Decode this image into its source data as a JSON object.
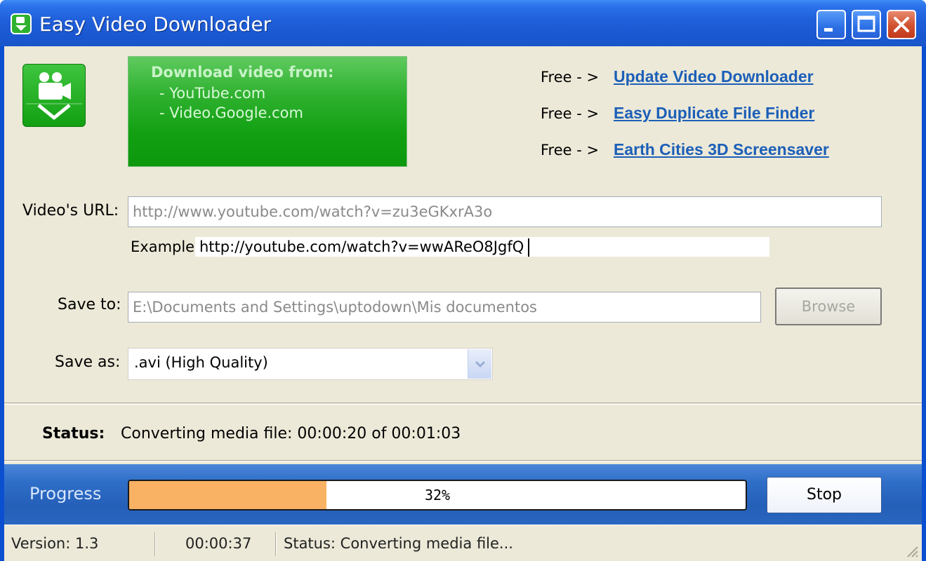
{
  "window": {
    "title": "Easy Video Downloader",
    "icon": "video-download-icon",
    "controls": [
      "minimize-icon",
      "maximize-icon",
      "close-icon"
    ]
  },
  "banner": {
    "title": "Download video from:",
    "sources": [
      "- YouTube.com",
      "- Video.Google.com"
    ]
  },
  "free_links": [
    {
      "prefix": "Free - >",
      "label": "Update Video Downloader"
    },
    {
      "prefix": "Free - >",
      "label": "Easy Duplicate File Finder"
    },
    {
      "prefix": "Free - >",
      "label": "Earth Cities 3D Screensaver"
    }
  ],
  "form": {
    "url_label": "Video's URL:",
    "url_value": "http://www.youtube.com/watch?v=zu3eGKxrA3o",
    "example_label": "Example:",
    "example_value": "http://youtube.com/watch?v=wwAReO8JgfQ",
    "save_to_label": "Save to:",
    "save_to_value": "E:\\Documents and Settings\\uptodown\\Mis documentos",
    "browse_label": "Browse",
    "save_as_label": "Save as:",
    "save_as_value": ".avi (High Quality)"
  },
  "status": {
    "label": "Status:",
    "text": "Converting media file: 00:00:20 of 00:01:03"
  },
  "progress": {
    "label": "Progress",
    "percent": 32,
    "percent_text": "32%",
    "fill_color": "#f9b264",
    "stop_label": "Stop"
  },
  "statusbar": {
    "version": "Version: 1.3",
    "elapsed": "00:00:37",
    "status": "Status: Converting media file..."
  },
  "colors": {
    "titlebar": "#1f5fd9",
    "banner": "#12a012",
    "link": "#1c5fb8",
    "progress_band": "#245fb8"
  }
}
